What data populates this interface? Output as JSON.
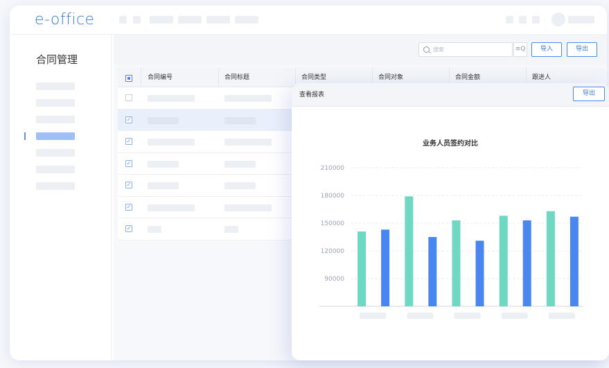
{
  "app": {
    "logo": "e-office"
  },
  "sidebar": {
    "title": "合同管理",
    "active_index": 3
  },
  "toolbar": {
    "search_placeholder": "搜索",
    "filter_icon": "≡Q",
    "import_label": "导入",
    "export_label": "导出"
  },
  "table": {
    "columns": [
      "合同编号",
      "合同标题",
      "合同类型",
      "合同对象",
      "合同金额",
      "跟进人"
    ],
    "rows": [
      {
        "checked": false,
        "selected": false
      },
      {
        "checked": true,
        "selected": true
      },
      {
        "checked": true,
        "selected": false
      },
      {
        "checked": true,
        "selected": false
      },
      {
        "checked": true,
        "selected": false
      },
      {
        "checked": true,
        "selected": false
      },
      {
        "checked": true,
        "selected": false
      }
    ]
  },
  "report": {
    "title": "查看报表",
    "export_label": "导出"
  },
  "chart_data": {
    "type": "bar",
    "title": "业务人员签约对比",
    "categories": [
      "",
      "",
      "",
      "",
      ""
    ],
    "ylim": [
      60000,
      210000
    ],
    "yticks": [
      90000,
      120000,
      150000,
      180000,
      210000
    ],
    "grid": true,
    "colors": [
      "#6fd8c3",
      "#4a86f0"
    ],
    "series": [
      {
        "values": [
          141000,
          179000,
          153000,
          158000,
          163000
        ]
      },
      {
        "values": [
          143000,
          135000,
          131000,
          153000,
          157000
        ]
      }
    ]
  }
}
